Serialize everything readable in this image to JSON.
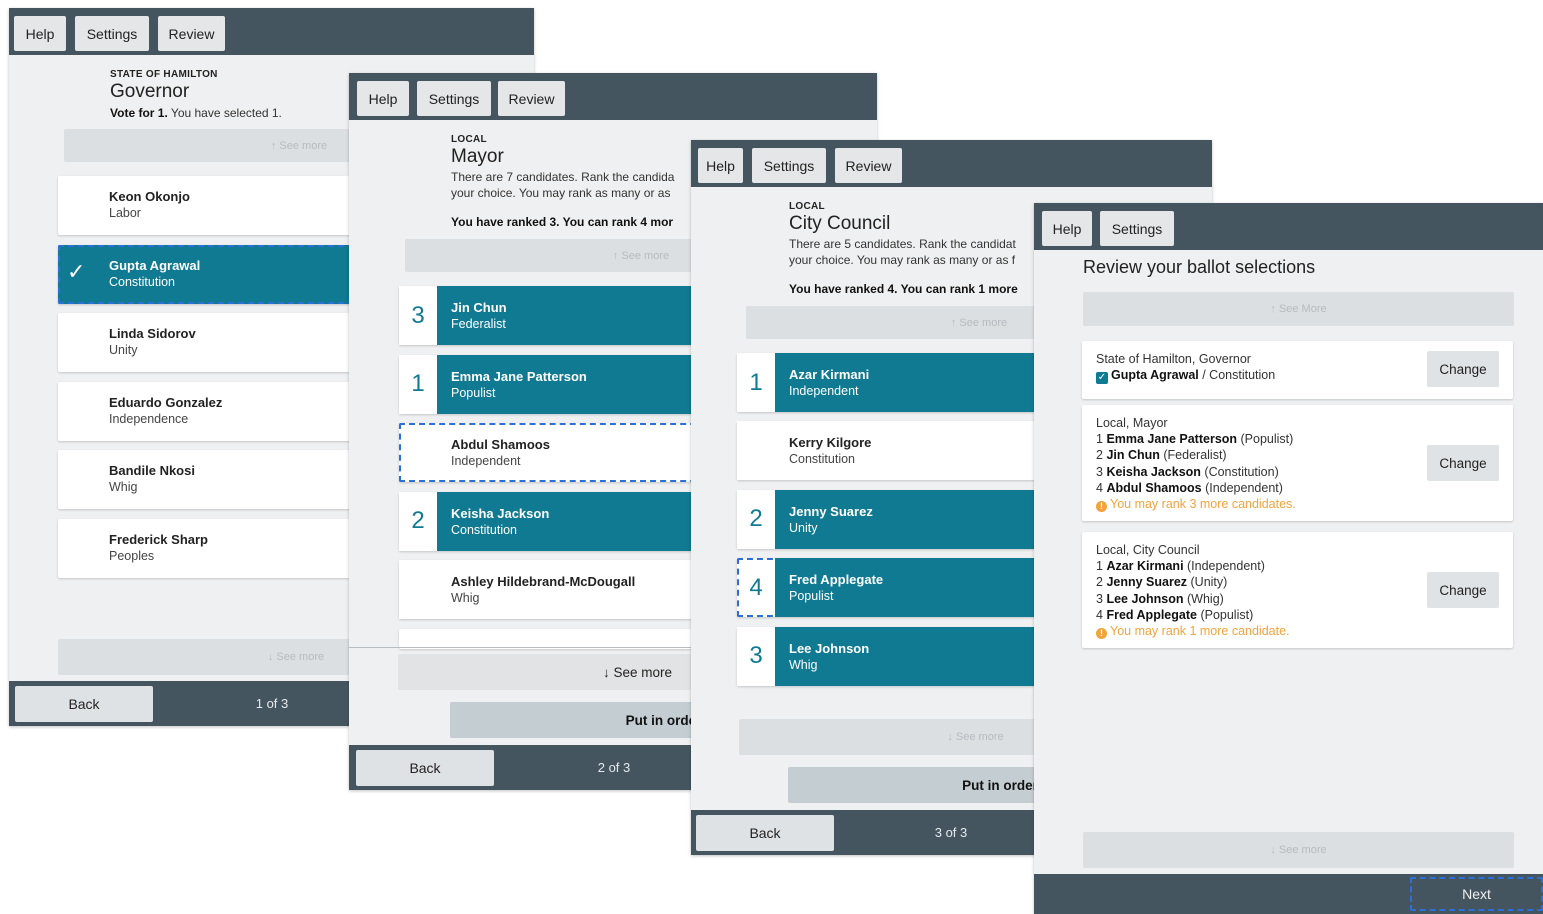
{
  "nav": {
    "help": "Help",
    "settings": "Settings",
    "review": "Review",
    "back": "Back",
    "next": "Next"
  },
  "panel1": {
    "jurisdiction": "STATE OF HAMILTON",
    "contest": "Governor",
    "instruction_bold": "Vote for 1.",
    "instruction_rest": " You have selected 1.",
    "see_more_top": "↑ See more",
    "see_more_bottom": "↓ See more",
    "candidates": [
      {
        "name": "Keon Okonjo",
        "party": "Labor",
        "selected": false
      },
      {
        "name": "Gupta Agrawal",
        "party": "Constitution",
        "selected": true
      },
      {
        "name": "Linda Sidorov",
        "party": "Unity",
        "selected": false
      },
      {
        "name": "Eduardo Gonzalez",
        "party": "Independence",
        "selected": false
      },
      {
        "name": "Bandile Nkosi",
        "party": "Whig",
        "selected": false
      },
      {
        "name": "Frederick Sharp",
        "party": "Peoples",
        "selected": false
      }
    ],
    "check_mark": "✓",
    "page": "1 of 3"
  },
  "panel2": {
    "jurisdiction": "LOCAL",
    "contest": "Mayor",
    "instruction_line1": "There are 7 candidates. Rank the candida",
    "instruction_line2": "your choice. You may rank as many or as",
    "ranked_status": "You have ranked 3. You can rank 4 mor",
    "see_more_top": "↑ See more",
    "candidates": [
      {
        "rank": "3",
        "name": "Jin Chun",
        "party": "Federalist",
        "selected": true
      },
      {
        "rank": "1",
        "name": "Emma Jane Patterson",
        "party": "Populist",
        "selected": true
      },
      {
        "rank": "",
        "name": "Abdul Shamoos",
        "party": "Independent",
        "selected": false
      },
      {
        "rank": "2",
        "name": "Keisha Jackson",
        "party": "Constitution",
        "selected": true
      },
      {
        "rank": "",
        "name": "Ashley Hildebrand-McDougall",
        "party": "Whig",
        "selected": false
      }
    ],
    "see_more": "↓ See more",
    "put_in_order": "Put in order",
    "page": "2 of 3"
  },
  "panel3": {
    "jurisdiction": "LOCAL",
    "contest": "City Council",
    "instruction_line1": "There are 5 candidates. Rank the candidat",
    "instruction_line2": "your choice. You may rank as many or as f",
    "ranked_status": "You have ranked 4. You can rank 1 more",
    "see_more_top": "↑ See more",
    "candidates": [
      {
        "rank": "1",
        "name": "Azar Kirmani",
        "party": "Independent",
        "selected": true
      },
      {
        "rank": "",
        "name": "Kerry Kilgore",
        "party": "Constitution",
        "selected": false
      },
      {
        "rank": "2",
        "name": "Jenny Suarez",
        "party": "Unity",
        "selected": true
      },
      {
        "rank": "4",
        "name": "Fred Applegate",
        "party": "Populist",
        "selected": true
      },
      {
        "rank": "3",
        "name": "Lee Johnson",
        "party": "Whig",
        "selected": true
      }
    ],
    "see_more_bottom": "↓ See more",
    "put_in_order": "Put in order",
    "page": "3 of 3"
  },
  "panel4": {
    "title": "Review your ballot selections",
    "see_more_top": "↑ See More",
    "see_more_bottom": "↓ See more",
    "change": "Change",
    "contests": [
      {
        "heading": "State of Hamilton, Governor",
        "lines": [
          {
            "num": "",
            "name": "Gupta Agrawal",
            "party": " / Constitution"
          }
        ],
        "warning": ""
      },
      {
        "heading": "Local, Mayor",
        "lines": [
          {
            "num": "1",
            "name": "Emma Jane Patterson",
            "party": " (Populist)"
          },
          {
            "num": "2",
            "name": "Jin Chun",
            "party": " (Federalist)"
          },
          {
            "num": "3",
            "name": "Keisha Jackson",
            "party": " (Constitution)"
          },
          {
            "num": "4",
            "name": "Abdul Shamoos",
            "party": " (Independent)"
          }
        ],
        "warning": "You may rank 3 more candidates."
      },
      {
        "heading": "Local, City Council",
        "lines": [
          {
            "num": "1",
            "name": "Azar Kirmani",
            "party": " (Independent)"
          },
          {
            "num": "2",
            "name": "Jenny Suarez",
            "party": " (Unity)"
          },
          {
            "num": "3",
            "name": "Lee Johnson",
            "party": " (Whig)"
          },
          {
            "num": "4",
            "name": "Fred Applegate",
            "party": " (Populist)"
          }
        ],
        "warning": "You may rank 1 more candidate."
      }
    ]
  },
  "colors": {
    "teal": "#0f7a92",
    "slate": "#455560",
    "warning": "#f2a33a",
    "focus": "#2b6fd8"
  }
}
